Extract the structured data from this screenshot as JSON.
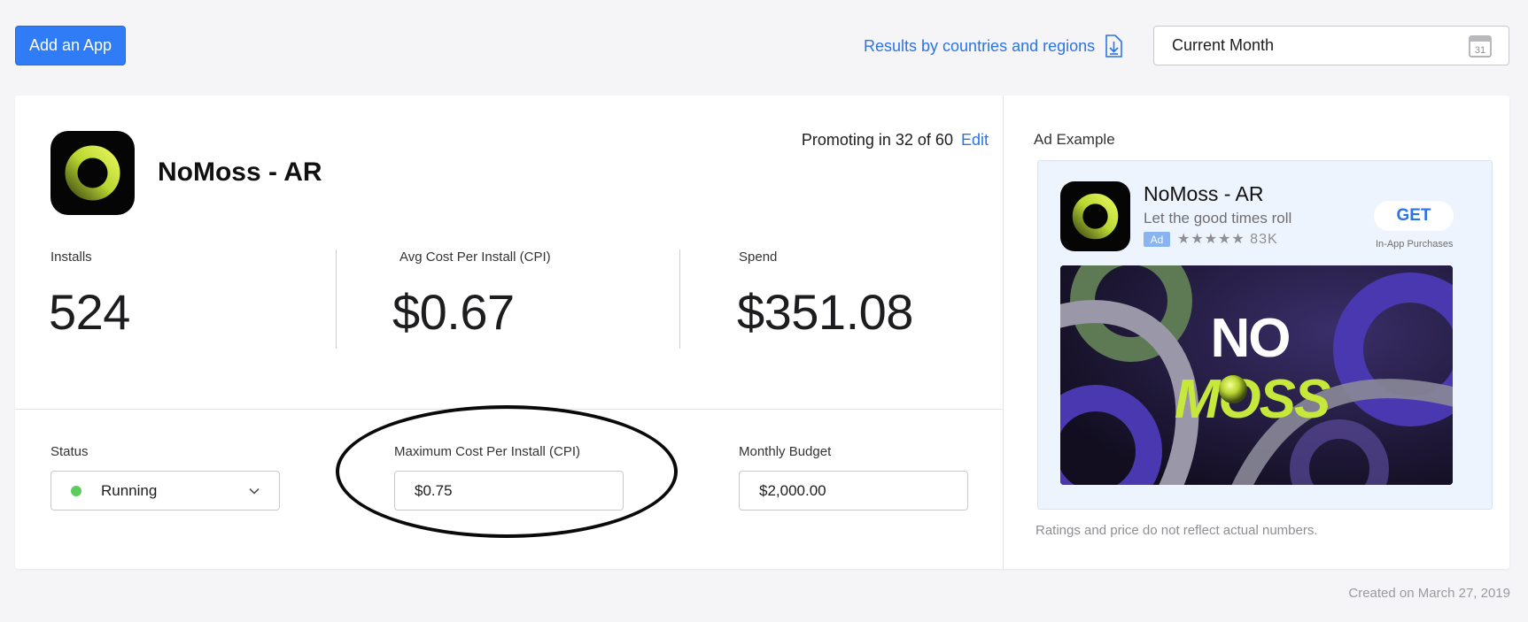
{
  "toolbar": {
    "add_app_label": "Add an App",
    "results_link_label": "Results by countries and regions",
    "date_range_value": "Current Month",
    "calendar_day": "31"
  },
  "app": {
    "name": "NoMoss - AR",
    "promoting_text": "Promoting in 32 of 60",
    "edit_label": "Edit"
  },
  "metrics": [
    {
      "label": "Installs",
      "value": "524"
    },
    {
      "label": "Avg Cost Per Install (CPI)",
      "value": "$0.67"
    },
    {
      "label": "Spend",
      "value": "$351.08"
    }
  ],
  "settings": {
    "status_label": "Status",
    "status_value": "Running",
    "status_color": "#5ccd5c",
    "max_cpi_label": "Maximum Cost Per Install (CPI)",
    "max_cpi_value": "$0.75",
    "budget_label": "Monthly Budget",
    "budget_value": "$2,000.00"
  },
  "ad_example": {
    "title": "Ad Example",
    "app_name": "NoMoss - AR",
    "subtitle": "Let the good times roll",
    "badge": "Ad",
    "stars": "★★★★★",
    "rating_count": "83K",
    "get_label": "GET",
    "iap_text": "In-App Purchases",
    "banner_line1": "NO",
    "banner_line2": "MOSS",
    "note": "Ratings and price do not reflect actual numbers."
  },
  "footer": {
    "created_text": "Created on March 27, 2019"
  },
  "colors": {
    "accent": "#2f7cf6",
    "link": "#2a74e6",
    "brand_lime": "#c6e83a"
  }
}
